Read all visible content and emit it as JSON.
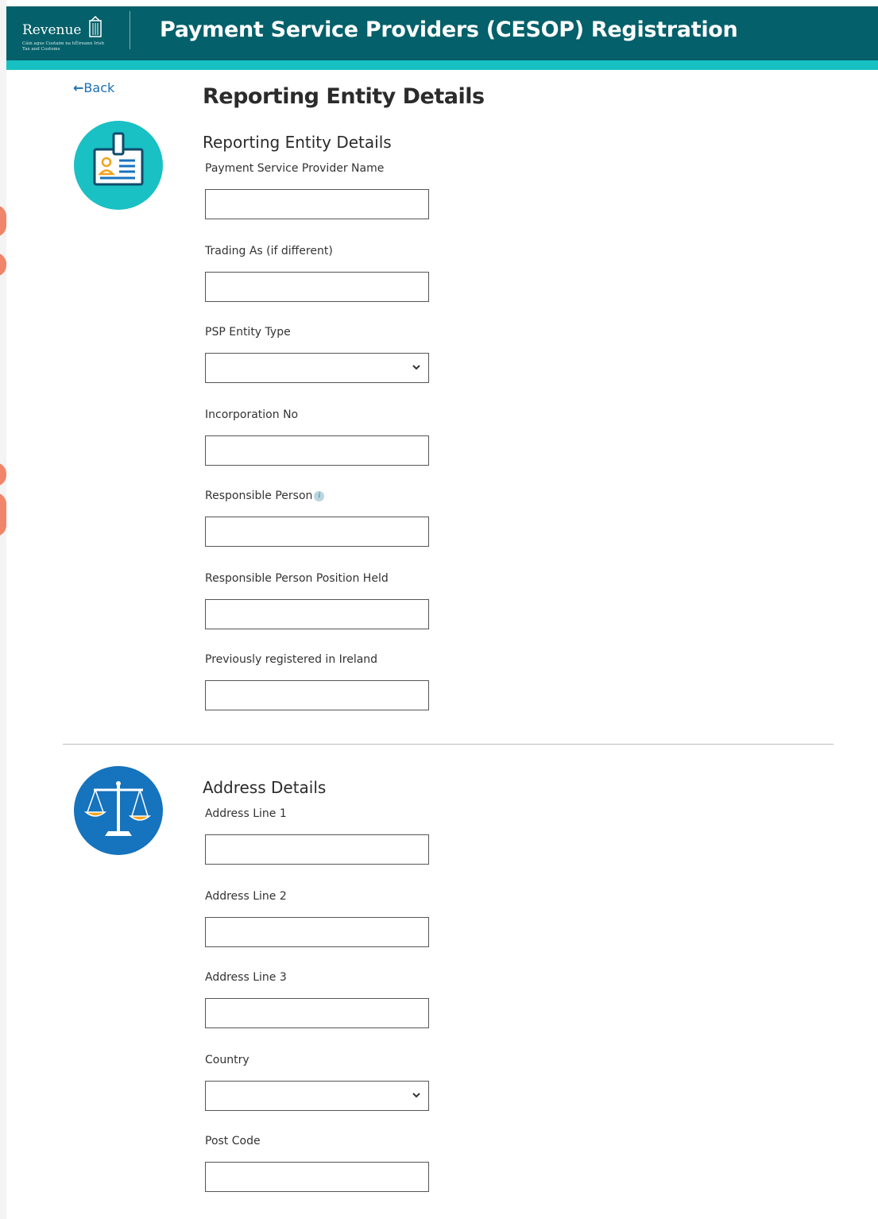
{
  "header": {
    "logo_text": "Revenue",
    "logo_tagline": "Cáin agus Custaim na hÉireann Irish Tax and Customs",
    "title": "Payment Service Providers (CESOP) Registration"
  },
  "nav": {
    "back_label": "Back"
  },
  "page": {
    "title": "Reporting Entity Details"
  },
  "sections": {
    "entity": {
      "heading": "Reporting Entity Details",
      "icon": "id-badge-icon",
      "fields": [
        {
          "label": "Payment Service Provider Name",
          "type": "text",
          "value": ""
        },
        {
          "label": "Trading As (if different)",
          "type": "text",
          "value": ""
        },
        {
          "label": "PSP Entity Type",
          "type": "select",
          "value": ""
        },
        {
          "label": "Incorporation No",
          "type": "text",
          "value": ""
        },
        {
          "label": "Responsible Person",
          "type": "text",
          "value": "",
          "has_info": true
        },
        {
          "label": "Responsible Person Position Held",
          "type": "text",
          "value": ""
        },
        {
          "label": "Previously registered in Ireland",
          "type": "text",
          "value": ""
        }
      ]
    },
    "address": {
      "heading": "Address Details",
      "icon": "scales-icon",
      "fields": [
        {
          "label": "Address Line 1",
          "type": "text",
          "value": ""
        },
        {
          "label": "Address Line 2",
          "type": "text",
          "value": ""
        },
        {
          "label": "Address Line 3",
          "type": "text",
          "value": ""
        },
        {
          "label": "Country",
          "type": "select",
          "value": ""
        },
        {
          "label": "Post Code",
          "type": "text",
          "value": ""
        }
      ]
    }
  },
  "colors": {
    "header_bg": "#04606a",
    "header_accent": "#18c1c1",
    "link": "#1a6fb5",
    "entity_icon_bg": "#19c0c4",
    "address_icon_bg": "#1673bd"
  }
}
